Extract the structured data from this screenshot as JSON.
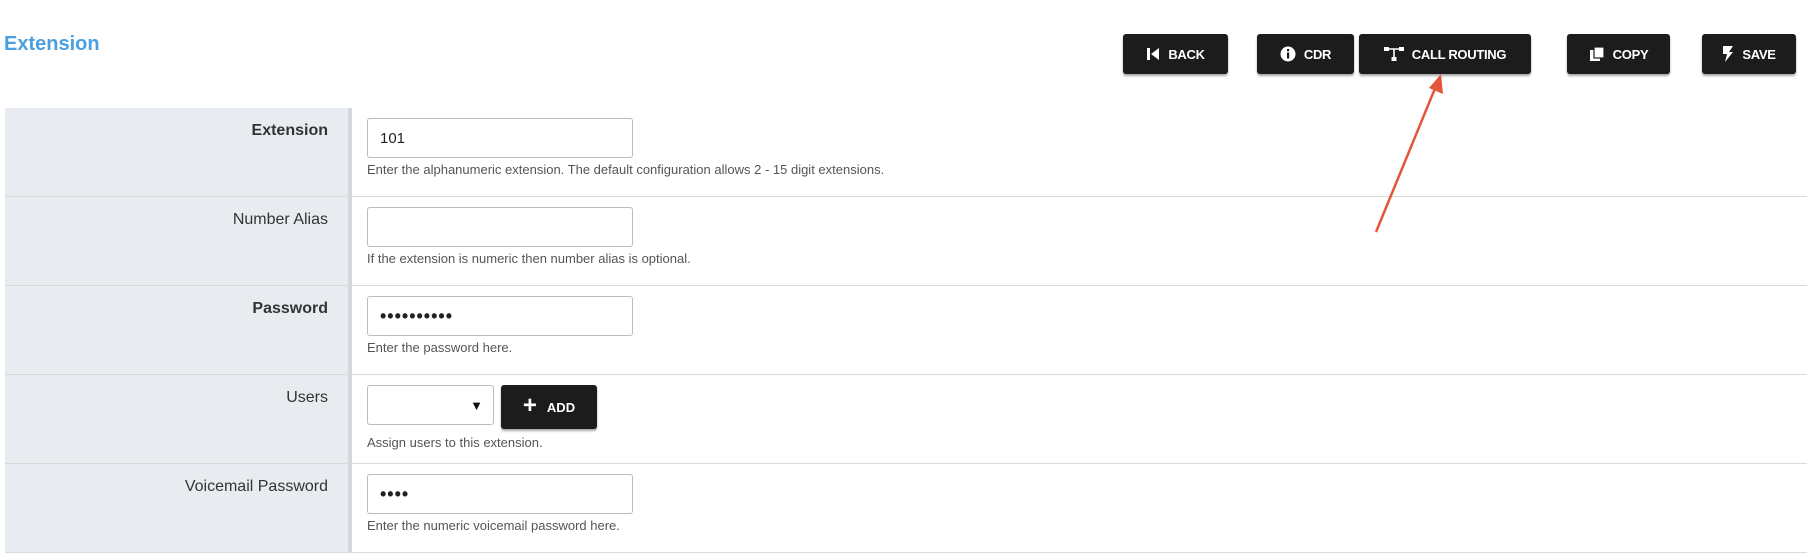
{
  "header": {
    "title": "Extension"
  },
  "toolbar": {
    "back_label": "BACK",
    "cdr_label": "CDR",
    "call_routing_label": "CALL ROUTING",
    "copy_label": "COPY",
    "save_label": "SAVE"
  },
  "form": {
    "extension": {
      "label": "Extension",
      "value": "101",
      "help": "Enter the alphanumeric extension. The default configuration allows 2 - 15 digit extensions."
    },
    "number_alias": {
      "label": "Number Alias",
      "value": "",
      "help": "If the extension is numeric then number alias is optional."
    },
    "password": {
      "label": "Password",
      "value": "••••••••••",
      "help": "Enter the password here."
    },
    "users": {
      "label": "Users",
      "selected": "",
      "add_label": "ADD",
      "help": "Assign users to this extension."
    },
    "voicemail_password": {
      "label": "Voicemail Password",
      "value": "••••",
      "help": "Enter the numeric voicemail password here."
    }
  },
  "icons": {
    "back": "skip-back-icon",
    "cdr": "info-icon",
    "call_routing": "routing-icon",
    "copy": "copy-icon",
    "save": "lightning-icon",
    "add": "plus-icon",
    "select": "caret-down-icon"
  },
  "colors": {
    "title": "#4a9fe0",
    "button_bg": "#1c1c1c",
    "label_bg": "#e8ecf1",
    "annotation_arrow": "#e4563a"
  }
}
